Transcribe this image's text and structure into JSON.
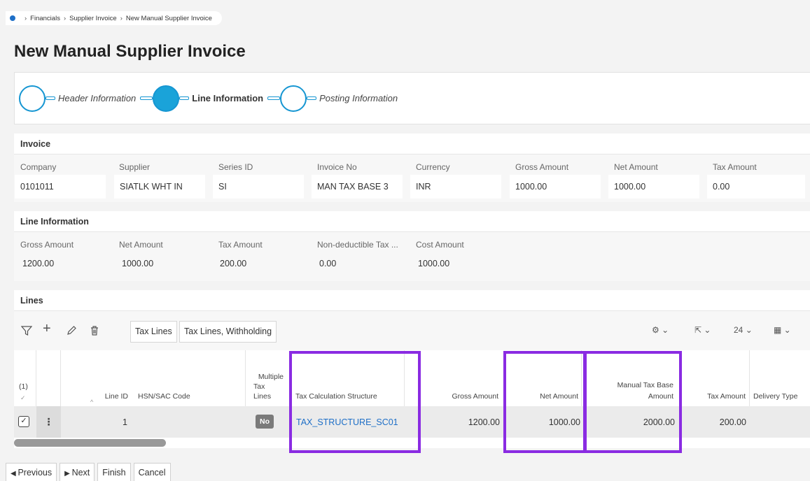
{
  "breadcrumb": {
    "items": [
      "Financials",
      "Supplier Invoice",
      "New Manual Supplier Invoice"
    ]
  },
  "page": {
    "title": "New Manual Supplier Invoice"
  },
  "steps": [
    {
      "label": "Header Information",
      "active": false
    },
    {
      "label": "Line Information",
      "active": true
    },
    {
      "label": "Posting Information",
      "active": false
    }
  ],
  "invoice": {
    "title": "Invoice",
    "fields": [
      {
        "label": "Company",
        "value": "0101011"
      },
      {
        "label": "Supplier",
        "value": "SIATLK WHT IN"
      },
      {
        "label": "Series ID",
        "value": "SI"
      },
      {
        "label": "Invoice No",
        "value": "MAN TAX BASE 3"
      },
      {
        "label": "Currency",
        "value": "INR"
      },
      {
        "label": "Gross Amount",
        "value": "1000.00"
      },
      {
        "label": "Net Amount",
        "value": "1000.00"
      },
      {
        "label": "Tax Amount",
        "value": "0.00"
      }
    ]
  },
  "line_information": {
    "title": "Line Information",
    "fields": [
      {
        "label": "Gross Amount",
        "value": "1200.00"
      },
      {
        "label": "Net Amount",
        "value": "1000.00"
      },
      {
        "label": "Tax Amount",
        "value": "200.00"
      },
      {
        "label": "Non-deductible Tax ...",
        "value": "0.00"
      },
      {
        "label": "Cost Amount",
        "value": "1000.00"
      }
    ]
  },
  "lines": {
    "title": "Lines",
    "toolbar": {
      "tab1": "Tax Lines",
      "tab2": "Tax Lines, Withholding",
      "page_size": "24",
      "icons": [
        "filter-icon",
        "plus-icon",
        "edit-icon",
        "delete-icon",
        "settings-icon",
        "export-icon",
        "table-icon"
      ]
    },
    "columns": {
      "select": "(1)",
      "line_id": "Line ID",
      "hsn": "HSN/SAC Code",
      "multiple_tax_1": "Multiple",
      "multiple_tax_2": "Tax",
      "multiple_tax_3": "Lines",
      "tax_calc": "Tax Calculation Structure",
      "gross": "Gross Amount",
      "net": "Net Amount",
      "manual_tax_1": "Manual Tax Base",
      "manual_tax_2": "Amount",
      "tax_amount": "Tax Amount",
      "delivery": "Delivery Type"
    },
    "rows": [
      {
        "line_id": "1",
        "hsn": "",
        "multiple_tax": "No",
        "tax_calc": "TAX_STRUCTURE_SC01",
        "gross": "1200.00",
        "net": "1000.00",
        "manual_tax_base": "2000.00",
        "tax_amount": "200.00",
        "delivery": ""
      }
    ]
  },
  "footer": {
    "previous": "Previous",
    "next": "Next",
    "finish": "Finish",
    "cancel": "Cancel"
  },
  "colors": {
    "accent": "#1aa3d9",
    "highlight": "#8a2be2",
    "link": "#1e6fc7"
  }
}
